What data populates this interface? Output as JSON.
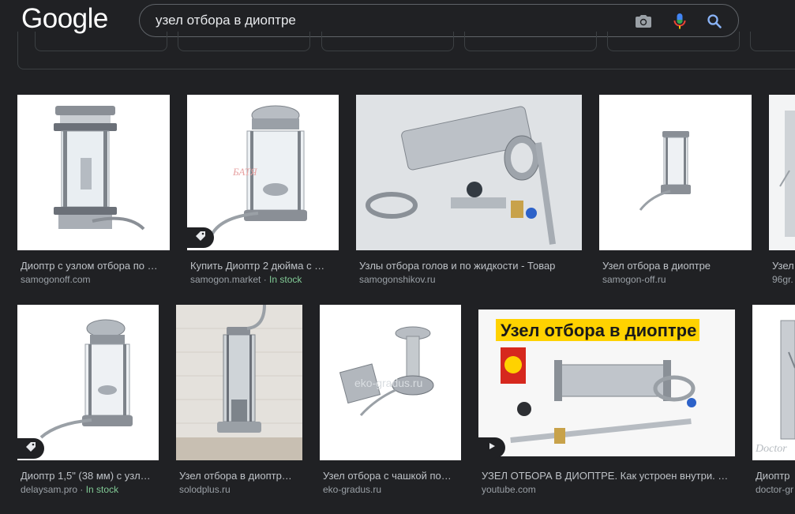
{
  "header": {
    "logo": "Google",
    "search_value": "узел отбора в диоптре"
  },
  "results": [
    {
      "title": "Диоптр с узлом отбора по …",
      "source": "samogonoff.com",
      "stock": ""
    },
    {
      "title": "Купить Диоптр 2 дюйма с …",
      "source": "samogon.market",
      "stock": "In stock"
    },
    {
      "title": "Узлы отбора голов и по жидкости - Товар",
      "source": "samogonshikov.ru",
      "stock": ""
    },
    {
      "title": "Узел отбора в диоптре",
      "source": "samogon-off.ru",
      "stock": ""
    },
    {
      "title": "Узел",
      "source": "96gr.",
      "stock": ""
    },
    {
      "title": "Диоптр 1,5\" (38 мм) с узл…",
      "source": "delaysam.pro",
      "stock": "In stock"
    },
    {
      "title": "Узел отбора в диоптр…",
      "source": "solodplus.ru",
      "stock": ""
    },
    {
      "title": "Узел отбора с чашкой по…",
      "source": "eko-gradus.ru",
      "stock": ""
    },
    {
      "title": "УЗЕЛ ОТБОРА В ДИОПТРЕ. Как устроен внутри. …",
      "source": "youtube.com",
      "stock": ""
    },
    {
      "title": "Диоптр",
      "source": "doctor-gr",
      "stock": ""
    }
  ],
  "image_text": {
    "watermark_2": "БАТЯ",
    "youtube_banner": "Узел отбора в диоптре",
    "watermark_8": "eko-gradus.ru",
    "watermark_10": "Doctor"
  },
  "stock_separator": " · ",
  "icons": {
    "camera": "camera-icon",
    "mic": "microphone-icon",
    "search": "search-icon",
    "tag": "price-tag-icon",
    "play": "play-icon"
  },
  "colors": {
    "background": "#202124",
    "title_text": "#bdc1c6",
    "source_text": "#9aa0a6",
    "in_stock": "#81c995",
    "search_blue": "#8ab4f8",
    "banner_yellow": "#ffd200",
    "banner_red": "#d6281e"
  }
}
